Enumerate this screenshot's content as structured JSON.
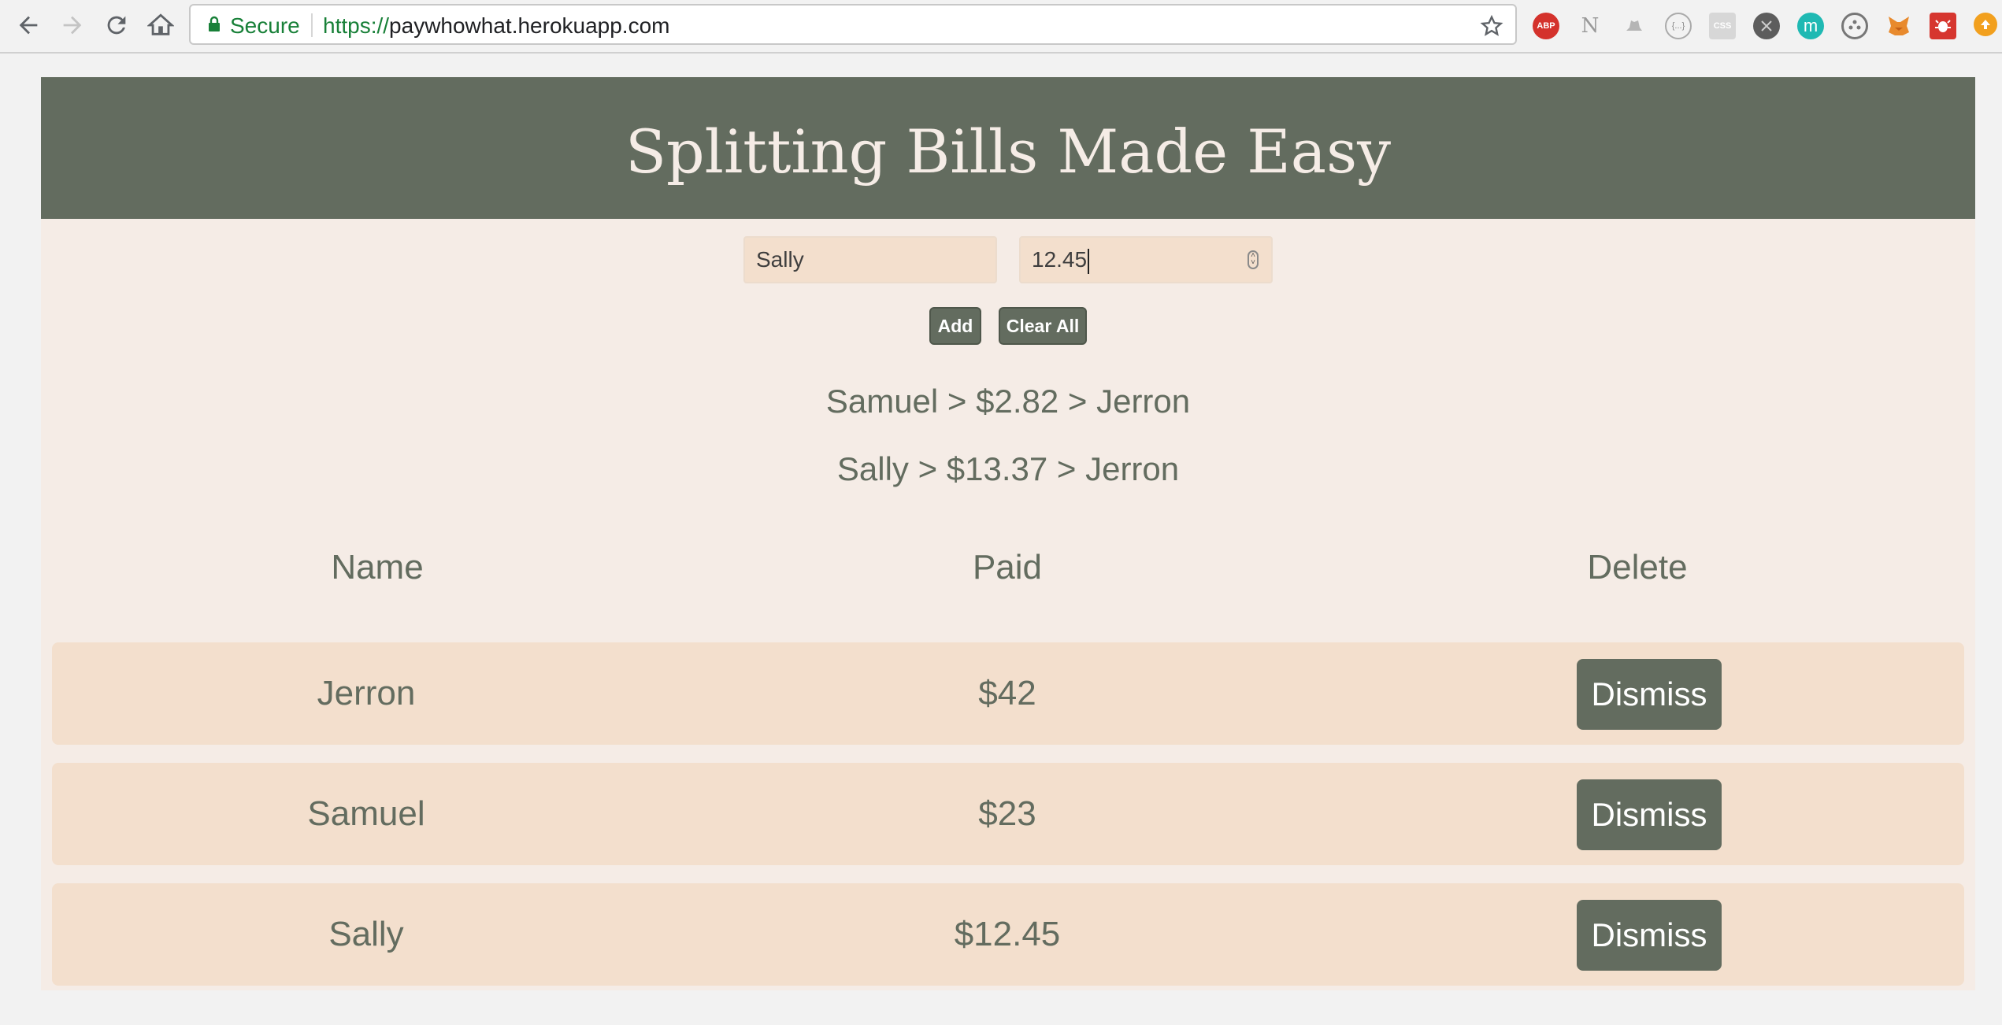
{
  "browser": {
    "secure_label": "Secure",
    "url_scheme": "https://",
    "url_host": "paywhowhat.herokuapp.com",
    "extensions": [
      {
        "name": "adblock-plus-icon",
        "label": "ABP"
      },
      {
        "name": "notion-icon",
        "label": "N"
      },
      {
        "name": "hat-icon",
        "label": ""
      },
      {
        "name": "brackets-icon",
        "label": "{...}"
      },
      {
        "name": "css-icon",
        "label": "CSS"
      },
      {
        "name": "dark-extension-icon",
        "label": ""
      },
      {
        "name": "m-extension-icon",
        "label": "m"
      },
      {
        "name": "film-reel-icon",
        "label": ""
      },
      {
        "name": "metamask-icon",
        "label": ""
      },
      {
        "name": "bug-icon",
        "label": ""
      },
      {
        "name": "upload-icon",
        "label": ""
      }
    ]
  },
  "header": {
    "title": "Splitting Bills Made Easy"
  },
  "form": {
    "name_value": "Sally",
    "amount_value": "12.45",
    "add_label": "Add",
    "clear_label": "Clear All"
  },
  "settlements": [
    "Samuel > $2.82 > Jerron",
    "Sally > $13.37 > Jerron"
  ],
  "table": {
    "headers": [
      "Name",
      "Paid",
      "Delete"
    ],
    "rows": [
      {
        "name": "Jerron",
        "paid": "$42",
        "action": "Dismiss"
      },
      {
        "name": "Samuel",
        "paid": "$23",
        "action": "Dismiss"
      },
      {
        "name": "Sally",
        "paid": "$12.45",
        "action": "Dismiss"
      }
    ]
  },
  "colors": {
    "brand": "#636c5f",
    "background": "#f5ece6",
    "row": "#f3dfcd"
  }
}
